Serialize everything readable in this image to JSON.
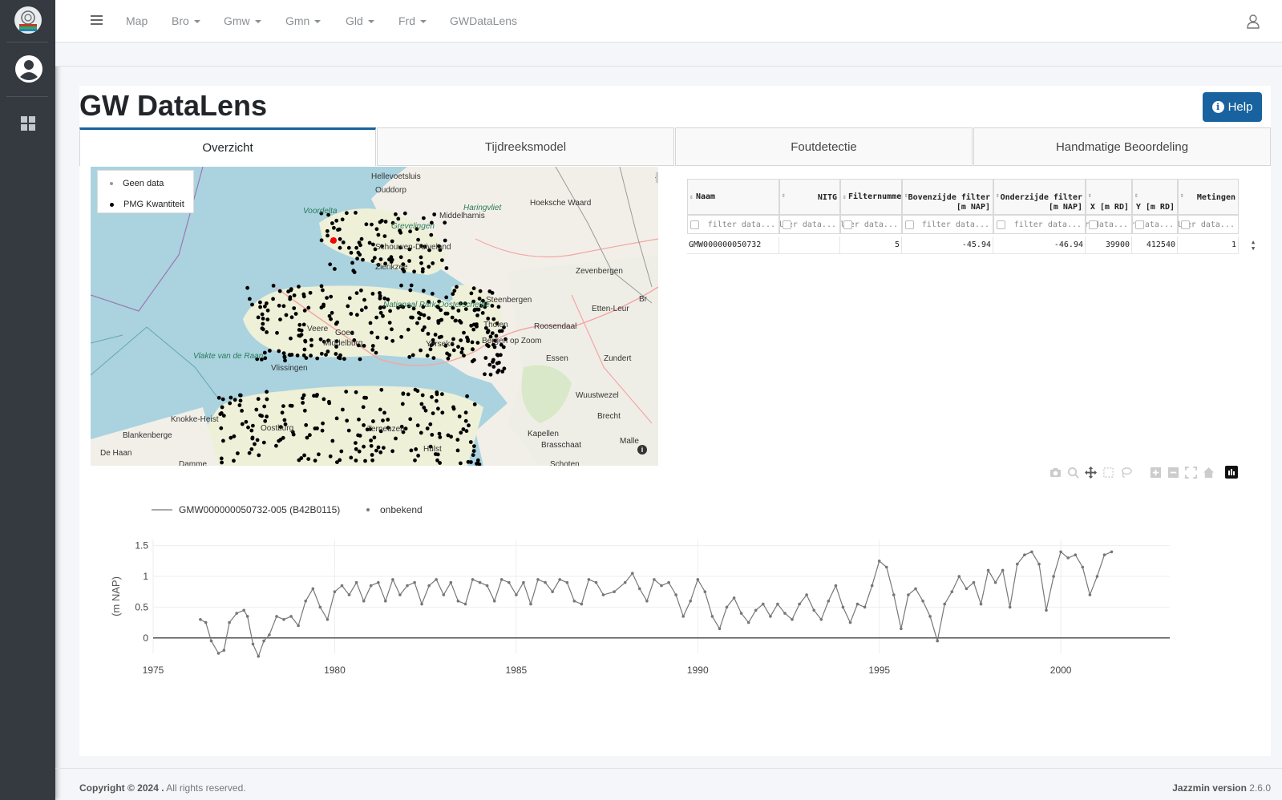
{
  "navbar": {
    "items": [
      "Map",
      "Bro",
      "Gmw",
      "Gmn",
      "Gld",
      "Frd",
      "GWDataLens"
    ],
    "dropdowns": [
      false,
      true,
      true,
      true,
      true,
      true,
      false
    ]
  },
  "page": {
    "title": "GW DataLens",
    "help_label": "Help"
  },
  "tabs": [
    {
      "label": "Overzicht",
      "active": true
    },
    {
      "label": "Tijdreeksmodel",
      "active": false
    },
    {
      "label": "Foutdetectie",
      "active": false
    },
    {
      "label": "Handmatige Beoordeling",
      "active": false
    }
  ],
  "map": {
    "legend": [
      {
        "label": "Geen data",
        "color": "#999999"
      },
      {
        "label": "PMG Kwantiteit",
        "color": "#000000"
      }
    ],
    "places": [
      "Hellevoetsluis",
      "Ouddorp",
      "Voordelta",
      "Haringvliet",
      "Middelharnis",
      "Hoeksche Waard",
      "Grevelingen",
      "Schouwen-Duiveland",
      "Zierikzee",
      "Zevenbergen",
      "Steenbergen",
      "Nationaal Park Oosterschelde",
      "Tholen",
      "Roosendaal",
      "Etten-Leur",
      "Bergen op Zoom",
      "Goes",
      "Veere",
      "Middelburg",
      "Vlissingen",
      "Vlakte van de Raan",
      "Essen",
      "Zundert",
      "Yerseke",
      "Wuustwezel",
      "Brecht",
      "Knokke-Heist",
      "Oostburg",
      "Terneuzen",
      "Hulst",
      "Blankenberge",
      "De Haan",
      "Damme",
      "Kapellen",
      "Brasschaat",
      "Schoten",
      "Malle",
      "Br"
    ],
    "colors": {
      "water": "#aad3df",
      "land": "#f2efe9",
      "dots": "#000000",
      "selected": "#ff0000"
    }
  },
  "table": {
    "headers": [
      "Naam",
      "NITG",
      "Filternummer",
      "Bovenzijde filter [m NAP]",
      "Onderzijde filter [m NAP]",
      "X [m RD]",
      "Y [m RD]",
      "Metingen"
    ],
    "filter_placeholders": [
      "filter data...",
      "filter data...",
      "filter data...",
      "filter data...",
      "filter data...",
      "filter data...",
      "filter data...",
      "filter data..."
    ],
    "rows": [
      [
        "GMW000000050732",
        "",
        "5",
        "-45.94",
        "-46.94",
        "39900",
        "412540",
        "1"
      ]
    ]
  },
  "chart_data": {
    "type": "line",
    "series": [
      {
        "name": "GMW000000050732-005 (B42B0115)",
        "color": "#777777"
      },
      {
        "name": "onbekend",
        "color": "#777777"
      }
    ],
    "x_range": [
      1975,
      2003
    ],
    "y_range": [
      -0.25,
      1.6
    ],
    "xticks": [
      1975,
      1980,
      1985,
      1990,
      1995,
      2000
    ],
    "yticks": [
      0,
      0.5,
      1,
      1.5
    ],
    "ylabel": "(m NAP)",
    "points": [
      [
        1976.3,
        0.3
      ],
      [
        1976.45,
        0.25
      ],
      [
        1976.6,
        -0.05
      ],
      [
        1976.8,
        -0.25
      ],
      [
        1976.95,
        -0.2
      ],
      [
        1977.1,
        0.25
      ],
      [
        1977.3,
        0.4
      ],
      [
        1977.5,
        0.45
      ],
      [
        1977.6,
        0.35
      ],
      [
        1977.75,
        -0.1
      ],
      [
        1977.9,
        -0.3
      ],
      [
        1978.05,
        -0.05
      ],
      [
        1978.2,
        0.05
      ],
      [
        1978.4,
        0.35
      ],
      [
        1978.6,
        0.3
      ],
      [
        1978.8,
        0.35
      ],
      [
        1979.0,
        0.2
      ],
      [
        1979.2,
        0.6
      ],
      [
        1979.4,
        0.8
      ],
      [
        1979.6,
        0.5
      ],
      [
        1979.8,
        0.3
      ],
      [
        1980.0,
        0.75
      ],
      [
        1980.2,
        0.85
      ],
      [
        1980.4,
        0.7
      ],
      [
        1980.6,
        0.9
      ],
      [
        1980.8,
        0.6
      ],
      [
        1981.0,
        0.85
      ],
      [
        1981.2,
        0.9
      ],
      [
        1981.4,
        0.6
      ],
      [
        1981.6,
        0.95
      ],
      [
        1981.8,
        0.7
      ],
      [
        1982.0,
        0.85
      ],
      [
        1982.2,
        0.9
      ],
      [
        1982.4,
        0.55
      ],
      [
        1982.6,
        0.85
      ],
      [
        1982.8,
        0.95
      ],
      [
        1983.0,
        0.7
      ],
      [
        1983.2,
        0.9
      ],
      [
        1983.4,
        0.6
      ],
      [
        1983.6,
        0.55
      ],
      [
        1983.8,
        0.95
      ],
      [
        1984.0,
        0.9
      ],
      [
        1984.2,
        0.85
      ],
      [
        1984.4,
        0.6
      ],
      [
        1984.6,
        0.95
      ],
      [
        1984.8,
        0.9
      ],
      [
        1985.0,
        0.7
      ],
      [
        1985.2,
        0.9
      ],
      [
        1985.4,
        0.55
      ],
      [
        1985.6,
        0.95
      ],
      [
        1985.8,
        0.9
      ],
      [
        1986.0,
        0.75
      ],
      [
        1986.2,
        0.95
      ],
      [
        1986.4,
        0.9
      ],
      [
        1986.6,
        0.6
      ],
      [
        1986.8,
        0.55
      ],
      [
        1987.0,
        0.95
      ],
      [
        1987.2,
        0.9
      ],
      [
        1987.4,
        0.7
      ],
      [
        1987.7,
        0.75
      ],
      [
        1988.0,
        0.9
      ],
      [
        1988.2,
        1.05
      ],
      [
        1988.4,
        0.8
      ],
      [
        1988.6,
        0.6
      ],
      [
        1988.8,
        0.95
      ],
      [
        1989.0,
        0.85
      ],
      [
        1989.2,
        0.9
      ],
      [
        1989.4,
        0.7
      ],
      [
        1989.6,
        0.35
      ],
      [
        1989.8,
        0.6
      ],
      [
        1990.0,
        0.95
      ],
      [
        1990.2,
        0.75
      ],
      [
        1990.4,
        0.35
      ],
      [
        1990.6,
        0.15
      ],
      [
        1990.8,
        0.5
      ],
      [
        1991.0,
        0.65
      ],
      [
        1991.2,
        0.4
      ],
      [
        1991.4,
        0.25
      ],
      [
        1991.6,
        0.45
      ],
      [
        1991.8,
        0.55
      ],
      [
        1992.0,
        0.35
      ],
      [
        1992.2,
        0.55
      ],
      [
        1992.4,
        0.4
      ],
      [
        1992.6,
        0.3
      ],
      [
        1992.8,
        0.55
      ],
      [
        1993.0,
        0.7
      ],
      [
        1993.2,
        0.45
      ],
      [
        1993.4,
        0.3
      ],
      [
        1993.6,
        0.6
      ],
      [
        1993.8,
        0.85
      ],
      [
        1994.0,
        0.5
      ],
      [
        1994.2,
        0.25
      ],
      [
        1994.4,
        0.55
      ],
      [
        1994.6,
        0.5
      ],
      [
        1994.8,
        0.85
      ],
      [
        1995.0,
        1.25
      ],
      [
        1995.2,
        1.15
      ],
      [
        1995.4,
        0.7
      ],
      [
        1995.6,
        0.15
      ],
      [
        1995.8,
        0.7
      ],
      [
        1996.0,
        0.8
      ],
      [
        1996.2,
        0.6
      ],
      [
        1996.4,
        0.35
      ],
      [
        1996.6,
        -0.05
      ],
      [
        1996.8,
        0.55
      ],
      [
        1997.0,
        0.75
      ],
      [
        1997.2,
        1.0
      ],
      [
        1997.4,
        0.8
      ],
      [
        1997.6,
        0.9
      ],
      [
        1997.8,
        0.55
      ],
      [
        1998.0,
        1.1
      ],
      [
        1998.2,
        0.9
      ],
      [
        1998.4,
        1.1
      ],
      [
        1998.6,
        0.5
      ],
      [
        1998.8,
        1.2
      ],
      [
        1999.0,
        1.35
      ],
      [
        1999.2,
        1.4
      ],
      [
        1999.4,
        1.2
      ],
      [
        1999.6,
        0.45
      ],
      [
        1999.8,
        1.0
      ],
      [
        2000.0,
        1.4
      ],
      [
        2000.2,
        1.3
      ],
      [
        2000.4,
        1.35
      ],
      [
        2000.6,
        1.15
      ],
      [
        2000.8,
        0.7
      ],
      [
        2001.0,
        1.0
      ],
      [
        2001.2,
        1.35
      ],
      [
        2001.4,
        1.4
      ]
    ]
  },
  "footer": {
    "copyright_bold": "Copyright © 2024 .",
    "copyright_rest": " All rights reserved.",
    "version_bold": "Jazzmin version",
    "version_num": "2.6.0"
  }
}
